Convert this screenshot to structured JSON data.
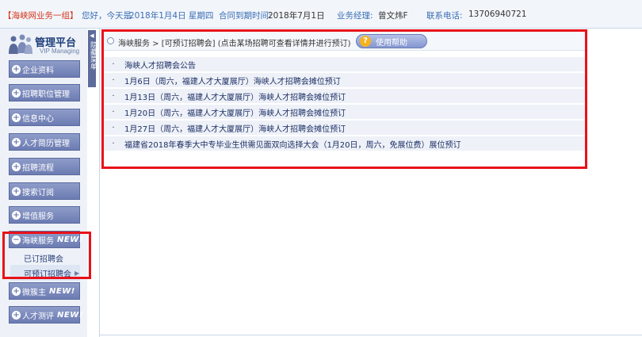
{
  "topbar": {
    "group": "【海峡网业务一组】",
    "greeting": "您好，今天是",
    "date": "2018年1月4日 星期四",
    "contract_label": "合同到期时间:",
    "contract_value": "2018年7月1日",
    "manager_label": "业务经理:",
    "manager_value": "曾文炜F",
    "phone_label": "联系电话:",
    "phone_value": "13706940721"
  },
  "sidebar": {
    "logo_title": "管理平台",
    "logo_sub": "VIP Managing",
    "collapse_label": "隐藏菜单",
    "items": [
      {
        "label": "企业资料"
      },
      {
        "label": "招聘职位管理"
      },
      {
        "label": "信息中心"
      },
      {
        "label": "人才简历管理"
      },
      {
        "label": "招聘流程"
      },
      {
        "label": "搜索订阅"
      },
      {
        "label": "增值服务"
      },
      {
        "label": "海峡服务",
        "badge": "NEW!"
      },
      {
        "label": "微簇主",
        "badge": "NEW!"
      },
      {
        "label": "人才测评",
        "badge": "NEW!"
      }
    ],
    "subitems": [
      {
        "label": "已订招聘会"
      },
      {
        "label": "可预订招聘会"
      }
    ]
  },
  "main": {
    "breadcrumb": "海峡服务 > [可预订招聘会] (点击某场招聘可查看详情并进行预订)",
    "help_label": "使用帮助",
    "bullet": "·",
    "rows": [
      "海峡人才招聘会公告",
      "1月6日（周六，福建人才大厦展厅）海峡人才招聘会摊位预订",
      "1月13日（周六，福建人才大厦展厅）海峡人才招聘会摊位预订",
      "1月20日（周六，福建人才大厦展厅）海峡人才招聘会摊位预订",
      "1月27日（周六，福建人才大厦展厅）海峡人才招聘会摊位预订",
      "福建省2018年春季大中专毕业生供需见面双向选择大会（1月20日，周六，免展位费）展位预订"
    ]
  },
  "colors": {
    "nav_button": "#7886bd",
    "highlight_box": "#e8121a",
    "link_text": "#1c2f66"
  }
}
